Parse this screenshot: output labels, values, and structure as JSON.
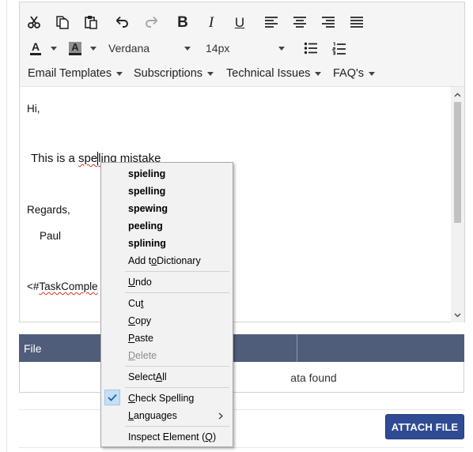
{
  "toolbar": {
    "row1": [
      "cut-icon",
      "copy-icon",
      "paste-icon",
      "undo-icon",
      "redo-icon",
      "bold-icon",
      "italic-icon",
      "underline-icon",
      "align-left-icon",
      "align-center-icon",
      "align-right-icon",
      "align-justify-icon"
    ],
    "bold_glyph": "B",
    "italic_glyph": "I",
    "underline_glyph": "U",
    "font_color_glyph": "A",
    "highlight_glyph": "A",
    "font_family": "Verdana",
    "font_size": "14px",
    "menus": [
      "Email Templates",
      "Subscriptions",
      "Technical Issues",
      "FAQ's"
    ]
  },
  "content": {
    "greeting": "Hi,",
    "sentence_before": "This is a ",
    "misspelled_part1": "spe",
    "misspelled_part2": "ling",
    "sentence_after": " mistake",
    "regards": "Regards,",
    "name": "Paul",
    "tag_prefix": "<#",
    "tag_word": "TaskComple"
  },
  "table": {
    "col_file": "File",
    "no_data_partial": "ata found"
  },
  "attach_button": "ATTACH FILE",
  "context_menu": {
    "suggestions": [
      "spieling",
      "spelling",
      "spewing",
      "peeling",
      "splining"
    ],
    "add_dict_a": "Add t",
    "add_dict_u": "o",
    "add_dict_b": " Dictionary",
    "undo_u": "U",
    "undo_b": "ndo",
    "cut_a": "Cu",
    "cut_u": "t",
    "copy_u": "C",
    "copy_b": "opy",
    "paste_u": "P",
    "paste_b": "aste",
    "delete_u": "D",
    "delete_b": "elete",
    "select_a": "Select ",
    "select_u": "A",
    "select_b": "ll",
    "check_u": "C",
    "check_b": "heck Spelling",
    "lang_u": "L",
    "lang_b": "anguages",
    "inspect_a": "Inspect Element (",
    "inspect_u": "Q",
    "inspect_b": ")"
  },
  "colors": {
    "table_header": "#4f5d7a",
    "attach_button": "#2f4b94",
    "misspell_underline": "#d93025",
    "check_highlight": "#c5dff5"
  }
}
